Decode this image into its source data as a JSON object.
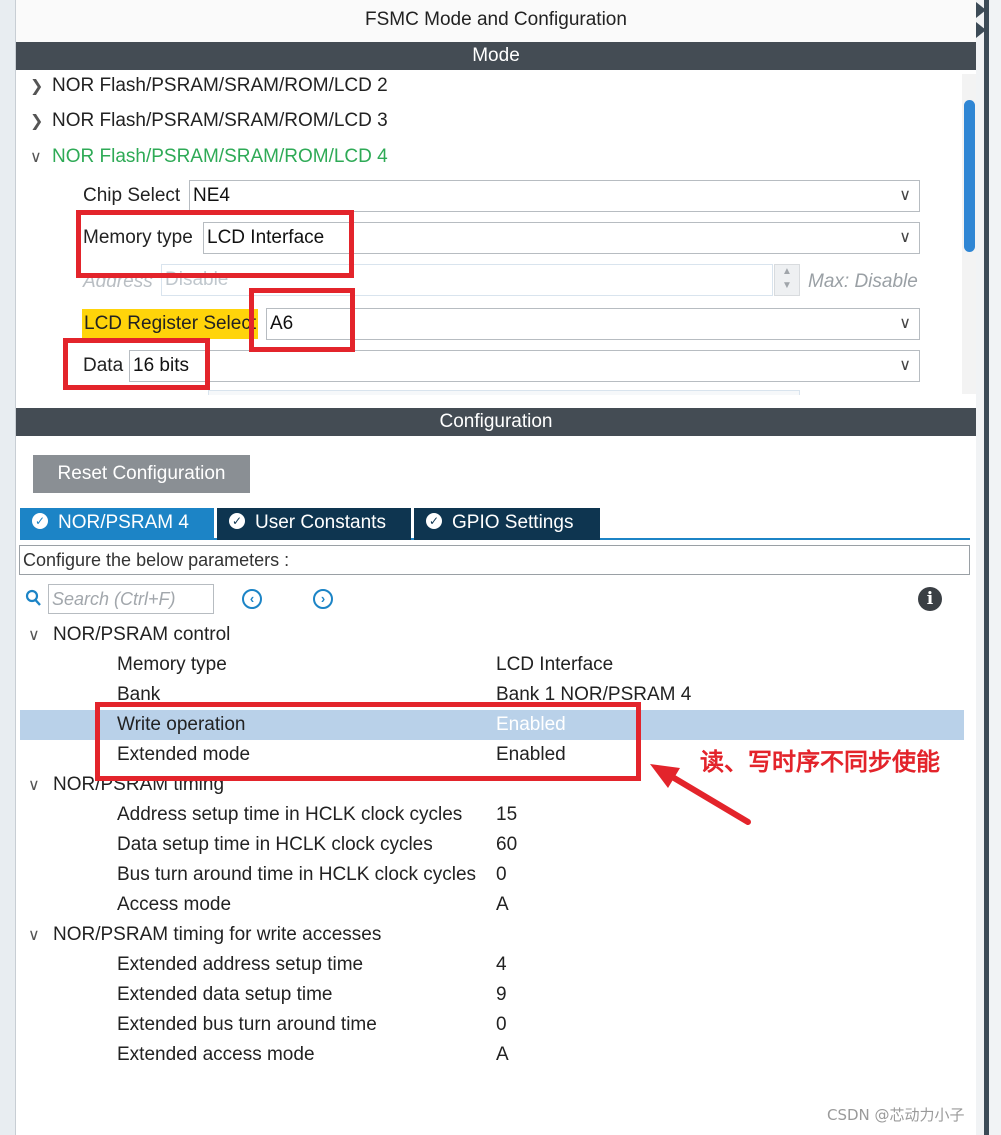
{
  "window": {
    "title": "FSMC Mode and Configuration"
  },
  "mode": {
    "header": "Mode",
    "tree": [
      {
        "label": "NOR Flash/PSRAM/SRAM/ROM/LCD 2",
        "expanded": false
      },
      {
        "label": "NOR Flash/PSRAM/SRAM/ROM/LCD 3",
        "expanded": false
      },
      {
        "label": "NOR Flash/PSRAM/SRAM/ROM/LCD 4",
        "expanded": true
      }
    ],
    "chip_select": {
      "label": "Chip Select",
      "value": "NE4"
    },
    "memory_type": {
      "label": "Memory type",
      "value": "LCD Interface"
    },
    "address": {
      "label": "Address",
      "value": "Disable",
      "max_note": "Max: Disable"
    },
    "lcd_register_select": {
      "label": "LCD Register Select",
      "value": "A6"
    },
    "data": {
      "label": "Data",
      "value": "16 bits"
    }
  },
  "configuration": {
    "header": "Configuration",
    "reset_button": "Reset Configuration",
    "tabs": [
      {
        "label": "NOR/PSRAM 4",
        "active": true
      },
      {
        "label": "User Constants",
        "active": false
      },
      {
        "label": "GPIO Settings",
        "active": false
      }
    ],
    "description": "Configure the below parameters :",
    "search_placeholder": "Search (Ctrl+F)",
    "groups": [
      {
        "title": "NOR/PSRAM control",
        "params": [
          {
            "name": "Memory type",
            "value": "LCD Interface"
          },
          {
            "name": "Bank",
            "value": "Bank 1 NOR/PSRAM 4"
          },
          {
            "name": "Write operation",
            "value": "Enabled",
            "selected": true
          },
          {
            "name": "Extended mode",
            "value": "Enabled"
          }
        ]
      },
      {
        "title": "NOR/PSRAM timing",
        "params": [
          {
            "name": "Address setup time in HCLK clock cycles",
            "value": "15"
          },
          {
            "name": "Data setup time in HCLK clock cycles",
            "value": "60"
          },
          {
            "name": "Bus turn around time in HCLK clock cycles",
            "value": "0"
          },
          {
            "name": "Access mode",
            "value": "A"
          }
        ]
      },
      {
        "title": "NOR/PSRAM timing for write accesses",
        "params": [
          {
            "name": "Extended address setup time",
            "value": "4"
          },
          {
            "name": "Extended data setup time",
            "value": "9"
          },
          {
            "name": "Extended bus turn around time",
            "value": "0"
          },
          {
            "name": "Extended access mode",
            "value": "A"
          }
        ]
      }
    ]
  },
  "annotation": {
    "text": "读、写时序不同步使能",
    "color": "#e3242b"
  },
  "watermark": "CSDN @芯动力小子",
  "colors": {
    "header_bg": "#444c54",
    "tab_active": "#1c84c6",
    "tab_inactive": "#0e3550",
    "tree_active": "#2eaa56",
    "highlight_yellow": "#ffd40a",
    "selected_row": "#b9d1e9"
  },
  "icons": {
    "chevron_collapsed": "chevron-right-icon",
    "chevron_expanded": "chevron-down-icon",
    "dropdown": "chevron-down-icon",
    "tab_status": "check-circle-icon",
    "search": "search-icon",
    "nav_prev": "circle-chevron-left-icon",
    "nav_next": "circle-chevron-right-icon",
    "info": "info-icon"
  }
}
